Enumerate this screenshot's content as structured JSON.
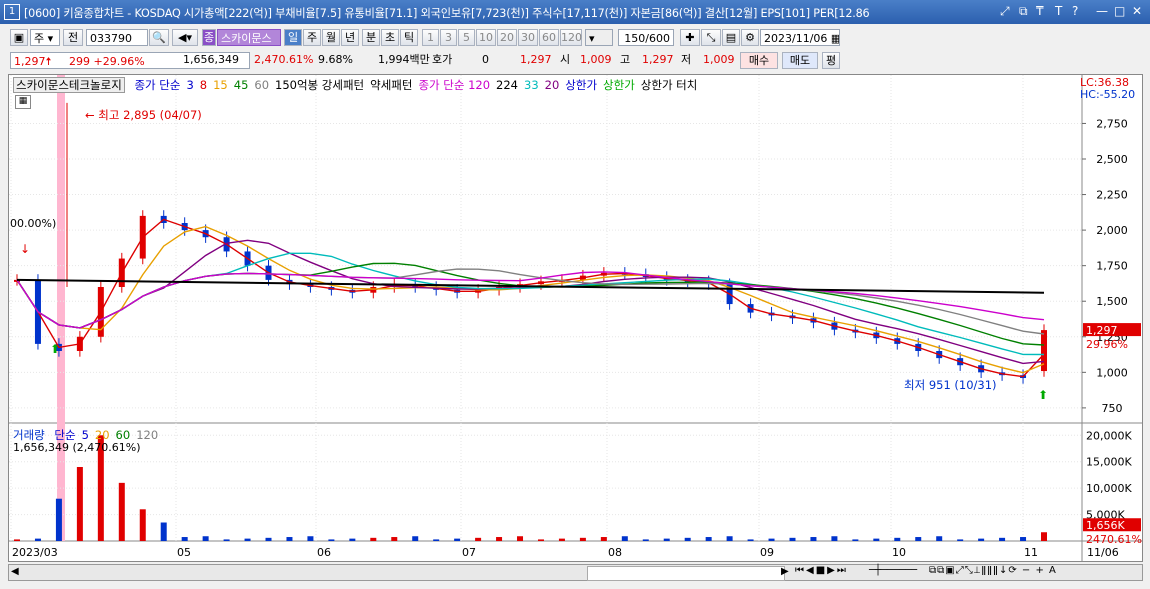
{
  "window": {
    "number": "1",
    "title": "[0600] 키움종합차트 - KOSDAQ 시가총액[222(억)] 부채비율[7.5] 유통비율[71.1] 외국인보유[7,723(천)] 주식수[17,117(천)] 자본금[86(억)] 결산[12월] EPS[101] PER[12.86",
    "controls": [
      "⤢",
      "⧉",
      "₸",
      "T",
      "?",
      "—",
      "□",
      "✕"
    ]
  },
  "toolbar": {
    "period_select": "주",
    "prev_label": "전",
    "code": "033790",
    "stock_badge": "종",
    "stock_name": "스카이문스",
    "period_buttons": [
      "일",
      "주",
      "월",
      "년",
      "분",
      "초",
      "틱"
    ],
    "active_period": "일",
    "interval_buttons": [
      "1",
      "3",
      "5",
      "10",
      "20",
      "30",
      "60",
      "120"
    ],
    "count": "150",
    "count_total": "/600",
    "date": "2023/11/06"
  },
  "quote": {
    "price": "1,297",
    "change": "299",
    "change_rate": "+29.96%",
    "volume": "1,656,349",
    "volume_rate": "2,470.61%",
    "turnover": "9.68%",
    "amount": "1,994백만",
    "hoga_label": "호가",
    "hoga_value": "0",
    "hoga_price": "1,297",
    "open_label": "시",
    "open": "1,009",
    "high_label": "고",
    "high": "1,297",
    "low_label": "저",
    "low": "1,009",
    "buy_label": "매수",
    "sell_label": "매도",
    "eval_label": "평"
  },
  "chart_data": [
    {
      "type": "candlestick",
      "title": "스카이문스테크놀로지",
      "legend": [
        {
          "text": "종가 단순",
          "color": "#0000cc"
        },
        {
          "text": "3",
          "color": "#0000cc"
        },
        {
          "text": "8",
          "color": "#dd0000"
        },
        {
          "text": "15",
          "color": "#e8a000"
        },
        {
          "text": "45",
          "color": "#008000"
        },
        {
          "text": "60",
          "color": "#808080"
        },
        {
          "text": "150억봉 강세패턴",
          "color": "#000000"
        },
        {
          "text": "약세패턴",
          "color": "#000000"
        },
        {
          "text": "종가 단순 120",
          "color": "#cc00cc"
        },
        {
          "text": "224",
          "color": "#000000"
        },
        {
          "text": "33",
          "color": "#00bbbb"
        },
        {
          "text": "20",
          "color": "#800080"
        },
        {
          "text": "상한가",
          "color": "#0000cc"
        },
        {
          "text": "상한가",
          "color": "#00aa00"
        },
        {
          "text": "상한가 터치",
          "color": "#000000"
        }
      ],
      "lc": "LC:36.38",
      "hc": "HC:-55.20",
      "ylim": [
        700,
        3000
      ],
      "y_ticks": [
        "2,750",
        "2,500",
        "2,250",
        "2,000",
        "1,750",
        "1,500",
        "1,250",
        "1,000",
        "750"
      ],
      "current_price_label": "1,297",
      "current_rate_label": "29.96%",
      "high_annotation": "최고 2,895 (04/07)",
      "low_annotation": "최저 951 (10/31)",
      "left_annotation": "00.00%)",
      "approx_closes": [
        1650,
        1200,
        1150,
        1250,
        1600,
        1800,
        2100,
        2050,
        2000,
        1950,
        1850,
        1750,
        1650,
        1620,
        1600,
        1580,
        1560,
        1600,
        1620,
        1600,
        1580,
        1560,
        1580,
        1600,
        1620,
        1640,
        1650,
        1680,
        1700,
        1690,
        1670,
        1650,
        1640,
        1620,
        1480,
        1420,
        1400,
        1380,
        1350,
        1300,
        1280,
        1240,
        1200,
        1150,
        1100,
        1050,
        1000,
        980,
        960,
        1297
      ]
    },
    {
      "type": "bar",
      "title": "거래량",
      "legend": [
        {
          "text": "단순",
          "color": "#0000cc"
        },
        {
          "text": "5",
          "color": "#0000cc"
        },
        {
          "text": "20",
          "color": "#e8a000"
        },
        {
          "text": "60",
          "color": "#008000"
        },
        {
          "text": "120",
          "color": "#808080"
        }
      ],
      "value_label": "1,656,349 (2,470.61%)",
      "y_ticks": [
        "20,000K",
        "15,000K",
        "10,000K",
        "5,000K"
      ],
      "current_label": "1,656K",
      "current_rate_label": "2470.61%"
    }
  ],
  "x_axis": {
    "labels": [
      "2023/03",
      "05",
      "06",
      "07",
      "08",
      "09",
      "10",
      "11",
      "11/06"
    ]
  },
  "colors": {
    "up": "#e00000",
    "down": "#0033cc",
    "highlight_band": "#ffb6d0"
  }
}
